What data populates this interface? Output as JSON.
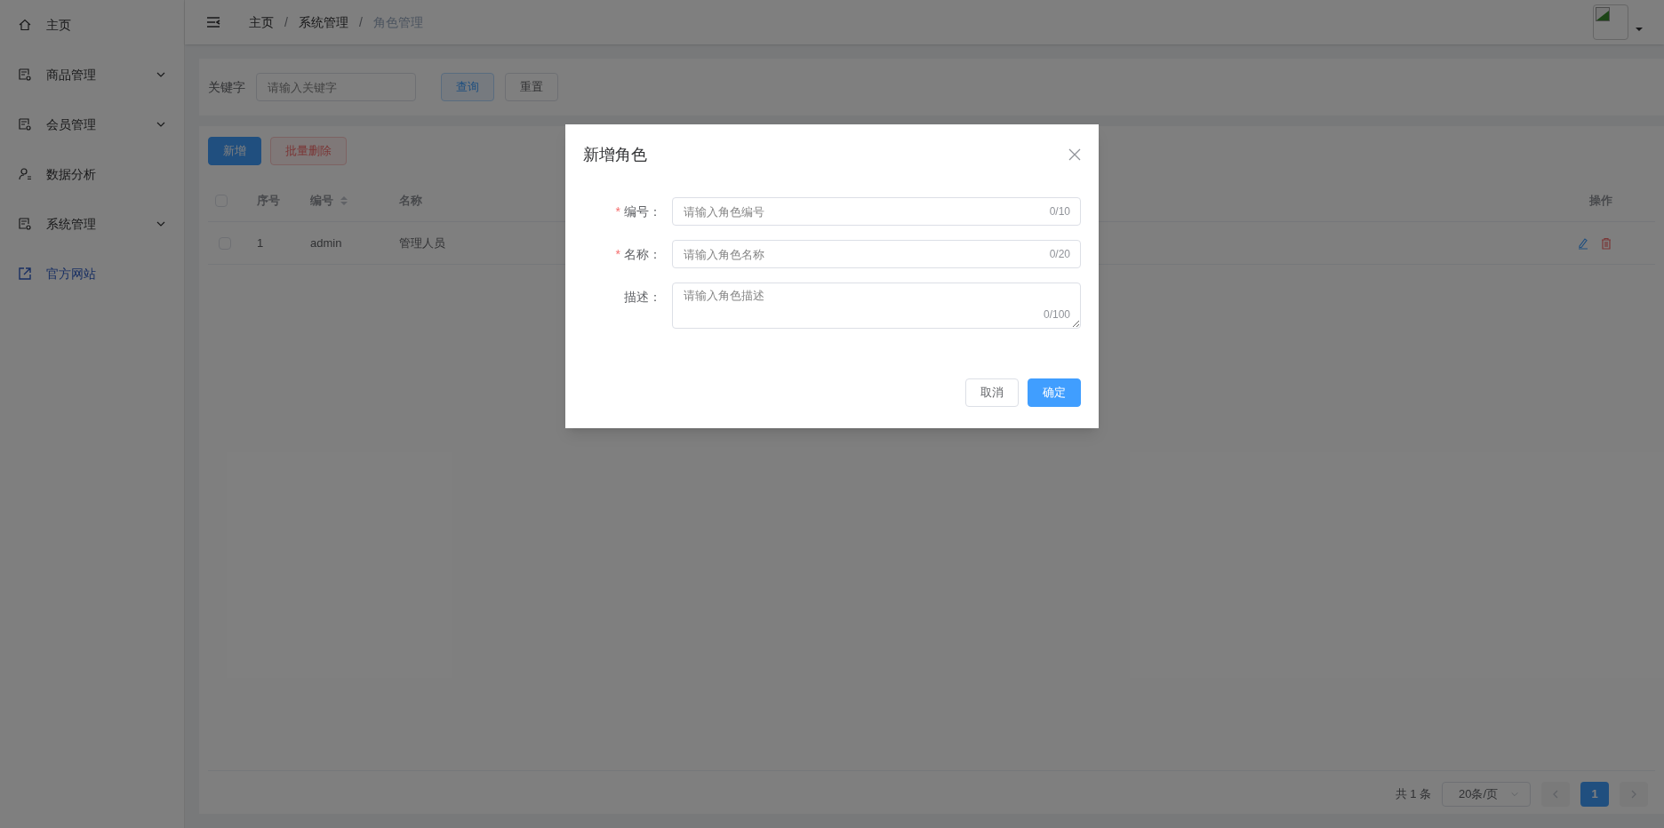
{
  "sidebar": {
    "items": [
      {
        "label": "主页",
        "expandable": false,
        "kind": "home"
      },
      {
        "label": "商品管理",
        "expandable": true,
        "kind": "module"
      },
      {
        "label": "会员管理",
        "expandable": true,
        "kind": "module"
      },
      {
        "label": "数据分析",
        "expandable": false,
        "kind": "user"
      },
      {
        "label": "系统管理",
        "expandable": true,
        "kind": "module"
      },
      {
        "label": "官方网站",
        "expandable": false,
        "kind": "link"
      }
    ]
  },
  "breadcrumb": [
    {
      "label": "主页",
      "current": false
    },
    {
      "label": "系统管理",
      "current": false
    },
    {
      "label": "角色管理",
      "current": true
    }
  ],
  "breadcrumb_separator": "/",
  "search": {
    "label": "关键字",
    "placeholder": "请输入关键字",
    "buttons": [
      {
        "label": "查询",
        "kind": "primary"
      },
      {
        "label": "重置",
        "kind": "default"
      }
    ]
  },
  "actions": [
    {
      "label": "新增",
      "kind": "primary"
    },
    {
      "label": "批量删除",
      "kind": "danger"
    }
  ],
  "table": {
    "all_checked": false,
    "columns": [
      {
        "label": "序号",
        "sortable": false
      },
      {
        "label": "编号",
        "sortable": true
      },
      {
        "label": "名称",
        "sortable": false
      }
    ],
    "action_column": "操作",
    "rows": [
      {
        "checked": false,
        "cells": [
          "1",
          "admin",
          "管理人员"
        ]
      }
    ]
  },
  "pagination": {
    "total": "共 1 条",
    "page_size": "20条/页",
    "pages": [
      {
        "label": "1",
        "selected": true
      }
    ]
  },
  "dialog": {
    "title": "新增角色",
    "fields": [
      {
        "label": "编号：",
        "required_mark": "*",
        "placeholder": "请输入角色编号",
        "counter": "0/10",
        "kind": "input"
      },
      {
        "label": "名称：",
        "required_mark": "*",
        "placeholder": "请输入角色名称",
        "counter": "0/20",
        "kind": "input"
      },
      {
        "label": "描述：",
        "placeholder": "请输入角色描述",
        "counter": "0/100",
        "kind": "textarea"
      }
    ],
    "buttons": [
      {
        "label": "取消",
        "kind": "default"
      },
      {
        "label": "确定",
        "kind": "primary"
      }
    ]
  }
}
